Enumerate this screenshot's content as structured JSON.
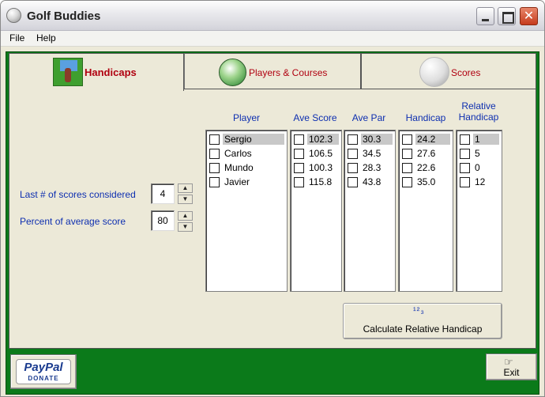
{
  "window": {
    "title": "Golf Buddies"
  },
  "menu": {
    "file": "File",
    "help": "Help"
  },
  "tabs": [
    {
      "label": "Handicaps",
      "icon": "golfer-icon",
      "active": true
    },
    {
      "label": "Players & Courses",
      "icon": "golf-team-icon",
      "active": false
    },
    {
      "label": "Scores",
      "icon": "golf-ball-icon",
      "active": false
    }
  ],
  "settings": {
    "last_scores_label": "Last # of scores considered",
    "last_scores_value": "4",
    "percent_label": "Percent of average score",
    "percent_value": "80"
  },
  "columns": {
    "player": "Player",
    "ave_score": "Ave Score",
    "ave_par": "Ave Par",
    "handicap": "Handicap",
    "relative_handicap_line1": "Relative",
    "relative_handicap_line2": "Handicap"
  },
  "players": [
    "Sergio",
    "Carlos",
    "Mundo",
    "Javier"
  ],
  "ave_scores": [
    "102.3",
    "106.5",
    "100.3",
    "115.8"
  ],
  "ave_pars": [
    "30.3",
    "34.5",
    "28.3",
    "43.8"
  ],
  "handicaps": [
    "24.2",
    "27.6",
    "22.6",
    "35.0"
  ],
  "relative_handicaps": [
    "1",
    "5",
    "0",
    "12"
  ],
  "buttons": {
    "calculate_icon": "¹²₃",
    "calculate": "Calculate Relative Handicap",
    "exit_icon": "☞",
    "exit": "Exit",
    "paypal_logo": "PayPal",
    "paypal_donate": "DONATE"
  }
}
